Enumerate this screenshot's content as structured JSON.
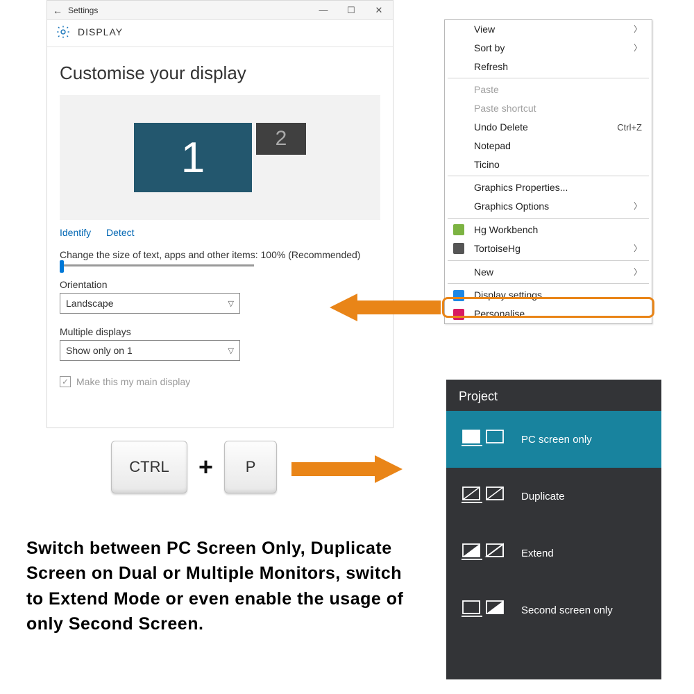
{
  "settings": {
    "window_title": "Settings",
    "section": "DISPLAY",
    "heading": "Customise your display",
    "monitor1": "1",
    "monitor2": "2",
    "identify": "Identify",
    "detect": "Detect",
    "scale_label": "Change the size of text, apps and other items: 100% (Recommended)",
    "orientation_label": "Orientation",
    "orientation_value": "Landscape",
    "multi_label": "Multiple displays",
    "multi_value": "Show only on 1",
    "main_display": "Make this my main display"
  },
  "context_menu": {
    "items": [
      {
        "label": "View",
        "arrow": true
      },
      {
        "label": "Sort by",
        "arrow": true
      },
      {
        "label": "Refresh"
      },
      {
        "sep": true
      },
      {
        "label": "Paste",
        "disabled": true
      },
      {
        "label": "Paste shortcut",
        "disabled": true
      },
      {
        "label": "Undo Delete",
        "shortcut": "Ctrl+Z"
      },
      {
        "label": "Notepad"
      },
      {
        "label": "Ticino"
      },
      {
        "sep": true
      },
      {
        "label": "Graphics Properties..."
      },
      {
        "label": "Graphics Options",
        "arrow": true
      },
      {
        "sep": true
      },
      {
        "label": "Hg Workbench",
        "icon": "hg"
      },
      {
        "label": "TortoiseHg",
        "icon": "tortoise",
        "arrow": true
      },
      {
        "sep": true
      },
      {
        "label": "New",
        "arrow": true
      },
      {
        "sep": true
      },
      {
        "label": "Display settings",
        "icon": "display",
        "highlight": true
      },
      {
        "label": "Personalise",
        "icon": "personalise"
      }
    ]
  },
  "keys": {
    "ctrl": "CTRL",
    "plus": "+",
    "p": "P"
  },
  "project": {
    "title": "Project",
    "items": [
      {
        "label": "PC screen only",
        "selected": true
      },
      {
        "label": "Duplicate"
      },
      {
        "label": "Extend"
      },
      {
        "label": "Second screen only"
      }
    ]
  },
  "caption": "Switch between PC Screen Only, Duplicate Screen on Dual or Multiple Monitors, switch to Extend Mode or even enable the usage of only Second Screen."
}
